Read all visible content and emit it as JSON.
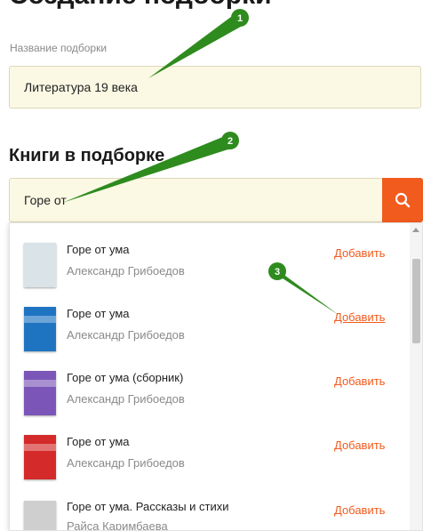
{
  "page": {
    "title": "Создание подборки"
  },
  "collection_name": {
    "label": "Название подборки",
    "value": "Литература 19 века"
  },
  "books_section": {
    "title": "Книги в подборке"
  },
  "search": {
    "value": "Горе от"
  },
  "results": [
    {
      "title": "Горе от ума",
      "author": "Александр Грибоедов",
      "add_label": "Добавить",
      "cover_color": "#d9e3e8"
    },
    {
      "title": "Горе от ума",
      "author": "Александр Грибоедов",
      "add_label": "Добавить",
      "cover_color": "#1f74c2"
    },
    {
      "title": "Горе от ума (сборник)",
      "author": "Александр Грибоедов",
      "add_label": "Добавить",
      "cover_color": "#7b56b8"
    },
    {
      "title": "Горе от ума",
      "author": "Александр Грибоедов",
      "add_label": "Добавить",
      "cover_color": "#d42a2a"
    },
    {
      "title": "Горе от ума. Рассказы и стихи",
      "author": "Райса Каримбаева",
      "add_label": "Добавить",
      "cover_color": "#cfcfcf"
    }
  ],
  "annotations": [
    "1",
    "2",
    "3"
  ],
  "colors": {
    "accent": "#f15b1d",
    "input_bg": "#fbf9e4",
    "marker": "#2e8b1e"
  }
}
